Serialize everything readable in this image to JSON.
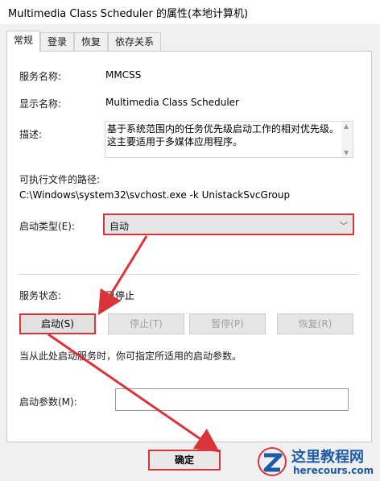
{
  "window": {
    "title": "Multimedia Class Scheduler 的属性(本地计算机)"
  },
  "tabs": [
    {
      "label": "常规",
      "active": true
    },
    {
      "label": "登录",
      "active": false
    },
    {
      "label": "恢复",
      "active": false
    },
    {
      "label": "依存关系",
      "active": false
    }
  ],
  "general": {
    "service_name_label": "服务名称:",
    "service_name": "MMCSS",
    "display_name_label": "显示名称:",
    "display_name": "Multimedia Class Scheduler",
    "description_label": "描述:",
    "description": "基于系统范围内的任务优先级启动工作的相对优先级。这主要适用于多媒体应用程序。",
    "exe_path_label": "可执行文件的路径:",
    "exe_path": "C:\\Windows\\system32\\svchost.exe -k UnistackSvcGroup",
    "startup_type_label": "启动类型(E):",
    "startup_type": "自动",
    "status_label": "服务状态:",
    "status": "已停止",
    "buttons": {
      "start": "启动(S)",
      "stop": "停止(T)",
      "pause": "暂停(P)",
      "resume": "恢复(R)"
    },
    "hint": "当从此处启动服务时，你可指定所适用的启动参数。",
    "params_label": "启动参数(M):",
    "params_value": ""
  },
  "footer": {
    "ok": "确定"
  },
  "watermark": {
    "brand": "这里教程网",
    "site": "herecours.com"
  },
  "colors": {
    "highlight": "#d9343a",
    "brand": "#1e5aa8"
  }
}
